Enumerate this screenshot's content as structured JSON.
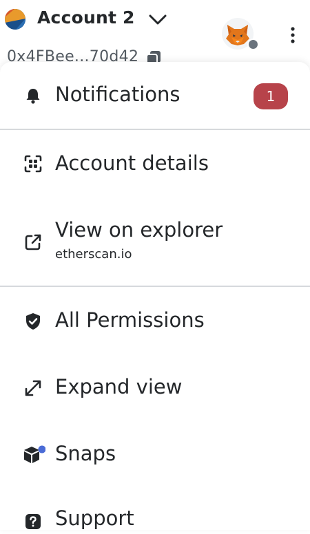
{
  "header": {
    "account_name": "Account 2",
    "address": "0x4FBee...70d42"
  },
  "menu": {
    "notifications": {
      "label": "Notifications",
      "badge": "1"
    },
    "account_details": {
      "label": "Account details"
    },
    "view_on_explorer": {
      "label": "View on explorer",
      "sublabel": "etherscan.io"
    },
    "all_permissions": {
      "label": "All Permissions"
    },
    "expand_view": {
      "label": "Expand view"
    },
    "snaps": {
      "label": "Snaps"
    },
    "support": {
      "label": "Support"
    }
  },
  "icons": {
    "account_avatar": "account-avatar-icon",
    "chevron": "chevron-down-icon",
    "fox": "metamask-fox-icon",
    "kebab": "more-vertical-icon",
    "copy": "copy-icon",
    "bell": "bell-icon",
    "account_details": "scan-qr-icon",
    "explorer": "external-link-icon",
    "permissions": "shield-check-icon",
    "expand": "expand-arrows-icon",
    "snaps": "snaps-cube-icon",
    "support": "question-icon"
  },
  "colors": {
    "badge": "#b7434a",
    "snaps_dot": "#4a6bd6",
    "text": "#24272a",
    "divider": "#d6d9dc"
  }
}
